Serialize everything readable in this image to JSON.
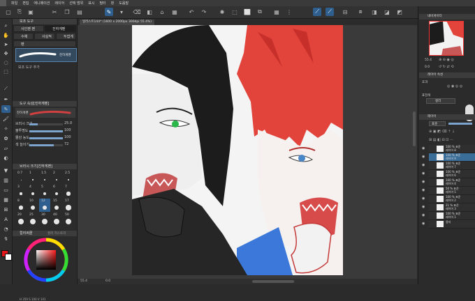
{
  "menu": {
    "items": [
      "파일",
      "편집",
      "애니메이션",
      "레이어",
      "선택 범위",
      "표시",
      "필터",
      "창",
      "도움말"
    ]
  },
  "tabs": {
    "document": "일러스트144* (1600 x 2000px 300dpi 55.4%)"
  },
  "subtool": {
    "title": "보조 도구",
    "tab_airbrush": "사인펜 펜",
    "tab_detail": "진하게펜",
    "tab_marker": "수채",
    "tab_sketch": "사실적펜",
    "tab_mix": "두껍게 칠",
    "tab_pen": "펜",
    "selected_brush": "진하게펜",
    "add_label": "보조 도구 추가"
  },
  "tool_property": {
    "title": "도구 속성[진하게펜]",
    "brush_name": "진하게펜",
    "rows": [
      {
        "label": "브러시 크기",
        "value": "25.0",
        "fraction": 0.25
      },
      {
        "label": "불투명도",
        "value": "100",
        "fraction": 1.0
      },
      {
        "label": "물감 농도",
        "value": "100",
        "fraction": 1.0
      },
      {
        "label": "색 늘이기",
        "value": "72",
        "fraction": 0.72
      }
    ]
  },
  "brush_size": {
    "title": "브러시 크기[진하게펜]",
    "sizes": [
      "0.7",
      "1",
      "1.5",
      "2",
      "2.5",
      "3",
      "4",
      "5",
      "6",
      "7",
      "8",
      "10",
      "12",
      "15",
      "17",
      "20",
      "25",
      "30",
      "40",
      "50"
    ]
  },
  "color": {
    "title": "컬러써클",
    "tab2": "컬러 히스토리",
    "readout": "H 359  S 100  V 101",
    "main_color": "#e3161b",
    "sub_color": "#ffffff"
  },
  "navigator": {
    "title": "내비게이터",
    "zoom": "55.4",
    "angle": "0.0"
  },
  "layer_property": {
    "title": "레이어 속성",
    "effect_label": "효과",
    "expression_label": "표현색",
    "expression_value": "컬러"
  },
  "layers": {
    "title": "레이어",
    "blend": "표준",
    "opacity": "100",
    "items": [
      {
        "pct": "100 % 표준",
        "name": "레이어 8"
      },
      {
        "pct": "100 % 표준",
        "name": "레이어 9"
      },
      {
        "pct": "100 % 표준",
        "name": "레이어 7"
      },
      {
        "pct": "100 % 표준",
        "name": "레이어 6"
      },
      {
        "pct": "100 % 표준",
        "name": "레이어 4"
      },
      {
        "pct": "50 % 표준",
        "name": "레이어 5"
      },
      {
        "pct": "100 % 표준",
        "name": "레이어 2"
      },
      {
        "pct": "21 % 표준",
        "name": "레이어 3"
      },
      {
        "pct": "100 % 표준",
        "name": "레이어 1"
      },
      {
        "pct": "",
        "name": "용지"
      }
    ]
  },
  "status": {
    "zoom": "55.4",
    "angle": "0.0"
  }
}
